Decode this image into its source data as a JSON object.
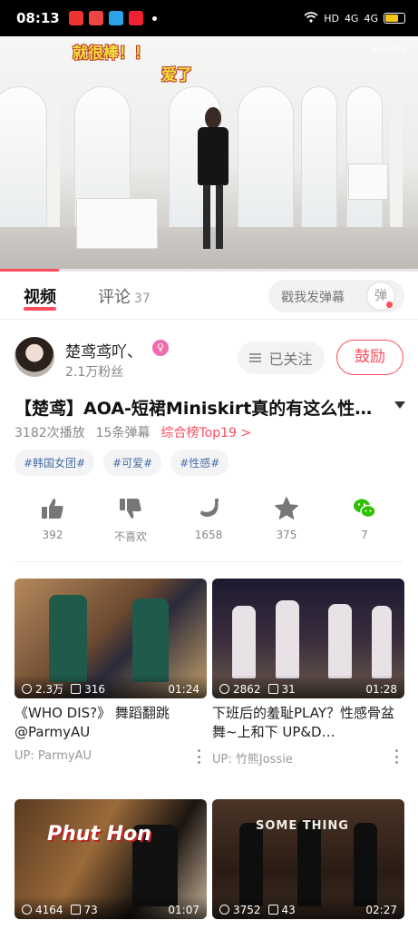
{
  "status_bar": {
    "time": "08:13",
    "network": "HD",
    "signal_1": "4G",
    "signal_2": "4G"
  },
  "player": {
    "danmaku": [
      "就很棒！！",
      "爱了"
    ],
    "brand": "AcFUN",
    "progress": 0.14
  },
  "tabs": {
    "video": "视频",
    "comments": "评论",
    "comments_count": "37",
    "danmu_placeholder": "戳我发弹幕",
    "danmu_toggle": "弹"
  },
  "uploader": {
    "name": "楚鸢鸢吖、",
    "fans": "2.1万粉丝",
    "follow_label": "已关注",
    "cheer_label": "鼓励"
  },
  "video": {
    "title": "【楚鸢】AOA-短裙Miniskirt真的有这么性…",
    "plays": "3182次播放",
    "danmu_count": "15条弹幕",
    "rank": "综合榜Top19 >",
    "tags": [
      "#韩国女团#",
      "#可爱#",
      "#性感#"
    ]
  },
  "actions": [
    {
      "icon": "thumbs-up-icon",
      "label": "392"
    },
    {
      "icon": "thumbs-down-icon",
      "label": "不喜欢"
    },
    {
      "icon": "banana-icon",
      "label": "1658"
    },
    {
      "icon": "star-icon",
      "label": "375"
    },
    {
      "icon": "wechat-icon",
      "label": "7",
      "color": "#2dc100"
    }
  ],
  "recommendations": [
    {
      "plays": "2.3万",
      "comments": "316",
      "duration": "01:24",
      "title": "《WHO DIS?》 舞蹈翻跳@ParmyAU",
      "up": "UP: ParmyAU"
    },
    {
      "plays": "2862",
      "comments": "31",
      "duration": "01:28",
      "title": "下班后的羞耻PLAY？性感骨盆舞~上和下 UP&D…",
      "up": "UP: 竹熊Jossie"
    },
    {
      "plays": "4164",
      "comments": "73",
      "duration": "01:07",
      "title": "",
      "up": "",
      "thumb_text": "Phut Hon"
    },
    {
      "plays": "3752",
      "comments": "43",
      "duration": "02:27",
      "title": "",
      "up": "",
      "thumb_text": "SOME THING"
    }
  ],
  "colors": {
    "accent": "#fd4c5c",
    "tag_text": "#4a6fa5"
  }
}
